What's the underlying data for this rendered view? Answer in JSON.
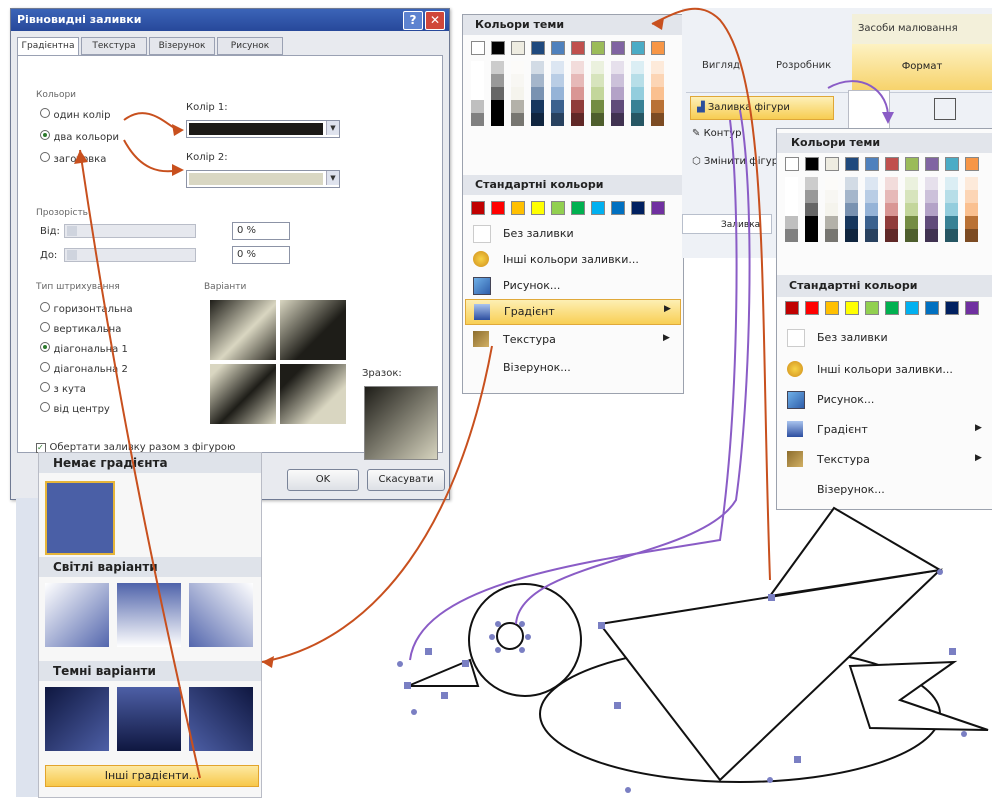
{
  "dialog": {
    "title": "Рiвновидні заливки",
    "tabs": [
      "Градієнтна",
      "Текстура",
      "Візерунок",
      "Рисунок"
    ],
    "help_label": "?",
    "close_label": "✕",
    "colors_group": "Кольори",
    "options": [
      "один колір",
      "два кольори",
      "заготовка"
    ],
    "color1_label": "Колір 1:",
    "color2_label": "Колір 2:",
    "transparency_group": "Прозорість",
    "from_label": "Від:",
    "to_label": "До:",
    "from_value": "0 %",
    "to_value": "0 %",
    "shading_group": "Тип штрихування",
    "shading_options": [
      "горизонтальна",
      "вертикальна",
      "діагональна 1",
      "діагональна 2",
      "з кута",
      "від центру"
    ],
    "variants_label": "Варіанти",
    "sample_label": "Зразок:",
    "rotate_label": "Обертати заливку разом з фігурою",
    "ok_label": "OK",
    "cancel_label": "Скасувати"
  },
  "gradient_panel": {
    "no_gradient": "Немає градієнта",
    "light": "Світлі варіанти",
    "dark": "Темні варіанти",
    "more": "Інші градієнти..."
  },
  "menu1": {
    "theme_colors": "Кольори теми",
    "standard_colors": "Стандартні кольори",
    "items": [
      "Без заливки",
      "Інші кольори заливки...",
      "Рисунок...",
      "Градієнт",
      "Текстура",
      "Візерунок..."
    ]
  },
  "ribbon": {
    "tab_tools": "Засоби малювання",
    "tab_view": "Вигляд",
    "tab_dev": "Розробник",
    "tab_format": "Формат",
    "fill_button": "Заливка фігури",
    "outline_button": "Контур",
    "change_button": "Змінити фігуру",
    "field_hint": "Заливка"
  },
  "menu2": {
    "theme_colors": "Кольори теми",
    "standard_colors": "Стандартні кольори",
    "items": [
      "Без заливки",
      "Інші кольори заливки...",
      "Рисунок...",
      "Градієнт",
      "Текстура",
      "Візерунок..."
    ]
  },
  "colors": {
    "theme_top": [
      "#ffffff",
      "#000000",
      "#eeece1",
      "#1f497d",
      "#4f81bd",
      "#c0504d",
      "#9bbb59",
      "#8064a2",
      "#4bacc6",
      "#f79646"
    ],
    "standard": [
      "#c00000",
      "#ff0000",
      "#ffc000",
      "#ffff00",
      "#92d050",
      "#00b050",
      "#00b0f0",
      "#0070c0",
      "#002060",
      "#7030a0"
    ],
    "arrow_orange": "#c8501e",
    "arrow_purple": "#8a5cc6"
  }
}
